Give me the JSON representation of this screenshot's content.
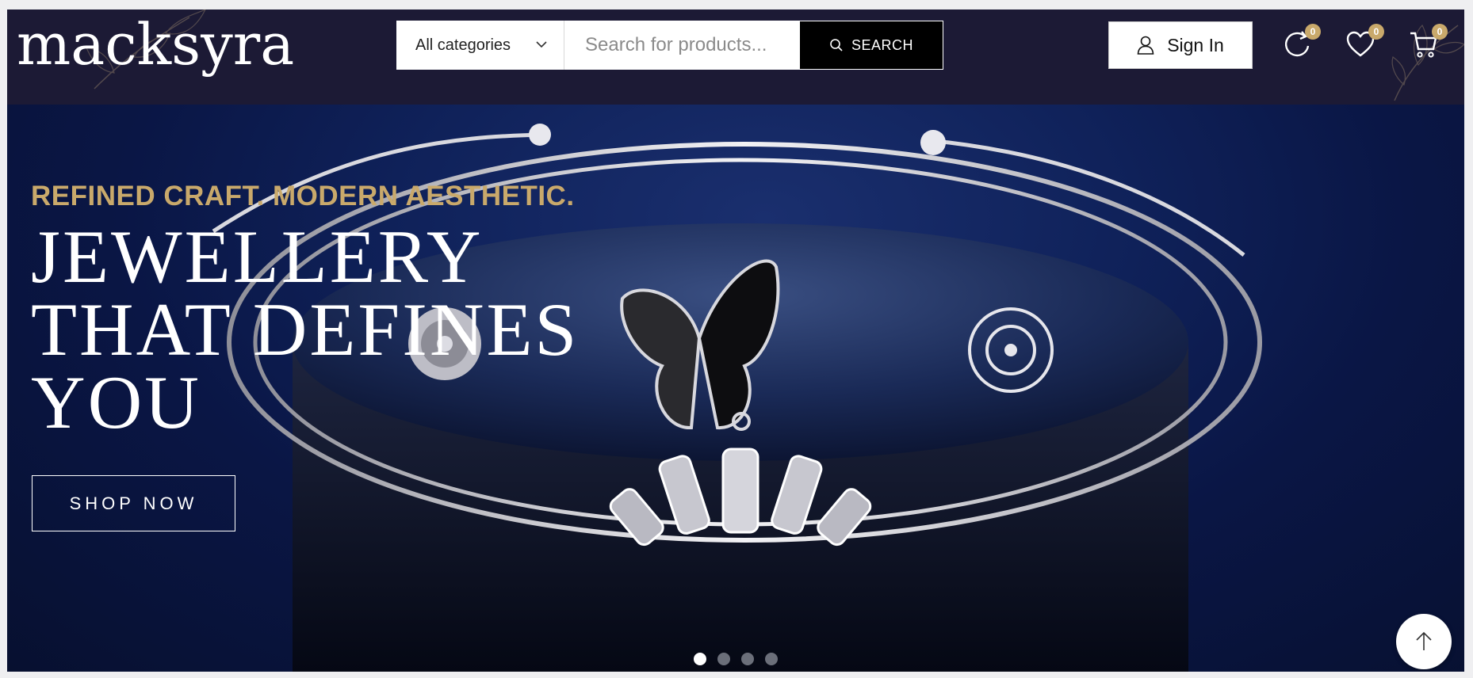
{
  "brand": {
    "logo_text": "macksyra"
  },
  "search": {
    "category_selected": "All categories",
    "placeholder": "Search for products...",
    "button_label": "SEARCH"
  },
  "account": {
    "signin_label": "Sign In"
  },
  "header_icons": {
    "compare": {
      "icon": "refresh-icon",
      "count": "0"
    },
    "wishlist": {
      "icon": "heart-icon",
      "count": "0"
    },
    "cart": {
      "icon": "cart-icon",
      "count": "0"
    }
  },
  "hero": {
    "eyebrow": "REFINED CRAFT. MODERN AESTHETIC.",
    "headline_lines": [
      "JEWELLERY",
      "THAT DEFINES",
      "YOU"
    ],
    "cta_label": "SHOP NOW",
    "slides_total": 4,
    "active_slide": 1
  },
  "colors": {
    "header_bg": "#1c1a35",
    "accent_gold": "#c9a96b",
    "hero_blue": "#0f2159"
  }
}
